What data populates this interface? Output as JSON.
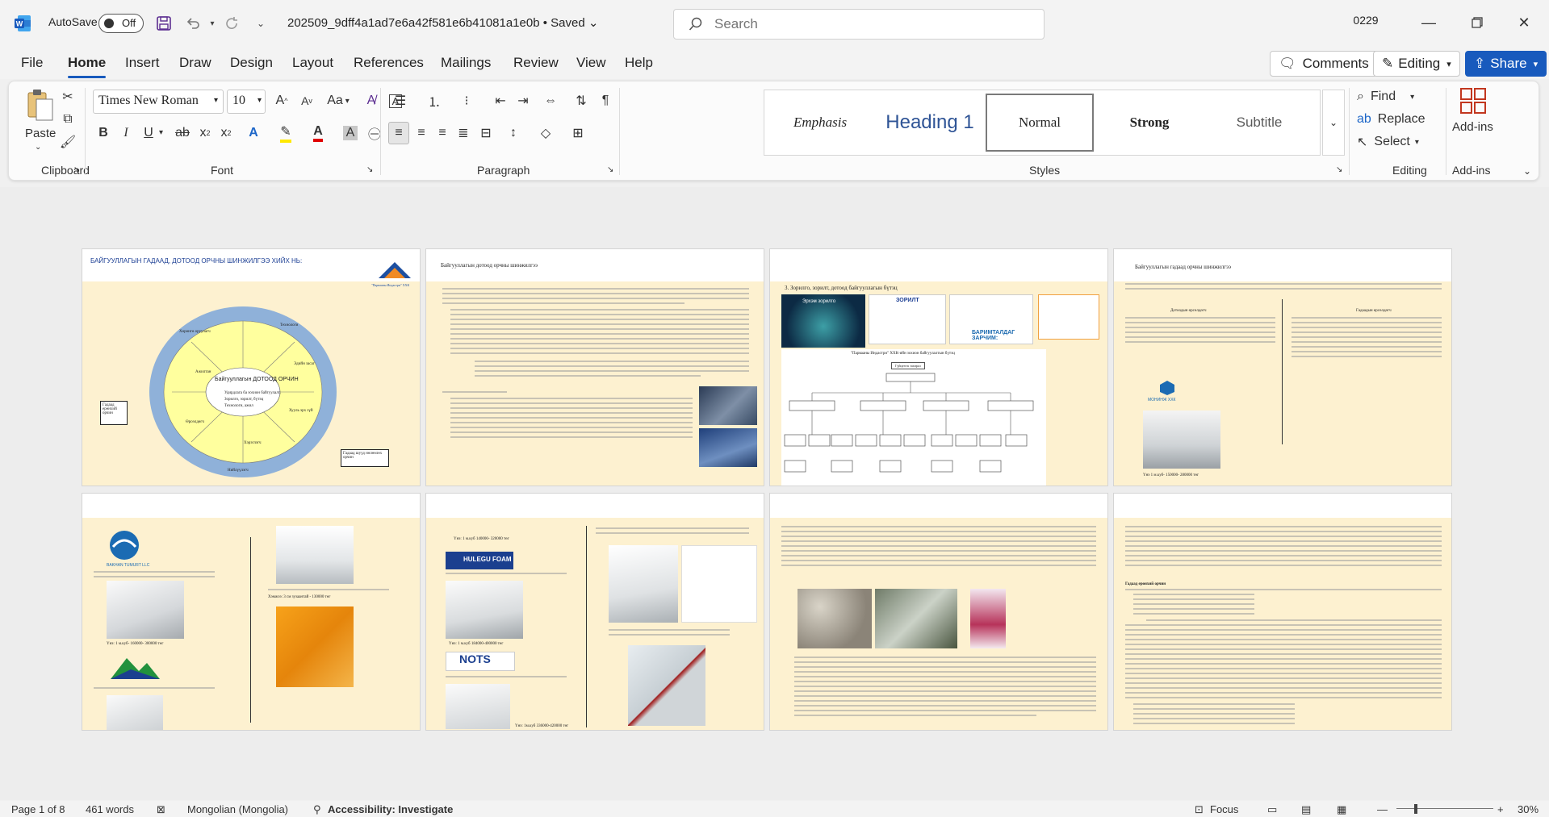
{
  "titlebar": {
    "autosave_label": "AutoSave",
    "autosave_state": "Off",
    "document_title": "202509_9dff4a1ad7e6a42f581e6b41081a1e0b",
    "save_status": "Saved",
    "user_badge": "0229"
  },
  "search": {
    "placeholder": "Search"
  },
  "menu": {
    "tabs": [
      "File",
      "Home",
      "Insert",
      "Draw",
      "Design",
      "Layout",
      "References",
      "Mailings",
      "Review",
      "View",
      "Help"
    ],
    "comments_label": "Comments",
    "editing_label": "Editing",
    "share_label": "Share"
  },
  "ribbon": {
    "clipboard": {
      "paste_label": "Paste",
      "group_label": "Clipboard"
    },
    "font": {
      "family": "Times New Roman",
      "size": "10",
      "group_label": "Font",
      "change_case": "Aa"
    },
    "paragraph": {
      "group_label": "Paragraph"
    },
    "styles": {
      "group_label": "Styles",
      "items": [
        "Emphasis",
        "Heading 1",
        "Normal",
        "Strong",
        "Subtitle"
      ],
      "selected": "Normal"
    },
    "editing": {
      "group_label": "Editing",
      "find": "Find",
      "replace": "Replace",
      "select": "Select"
    },
    "addins": {
      "label": "Add-ins",
      "group_label": "Add-ins"
    }
  },
  "pages": {
    "p1": {
      "heading": "БАЙГУУЛЛАГЫН ГАДААД, ДОТООД ОРЧНЫ ШИНЖИЛГЭЭ ХИЙХ НЬ:",
      "logo_caption": "\"Парвааны Индастри\" ХХК",
      "center_title": "Байгууллагын ДОТООД ОРЧИН",
      "center_items": [
        "Удирдлага ба зохион байгуулалт,",
        "Зорилго, зорилт, бүтэц",
        "Технологи, ажил"
      ],
      "outer_label": "Гадаад орчин",
      "sector_labels": [
        "Хөрөнгө оруулагч",
        "Технологи",
        "Эдийн засаг",
        "Ажилтан",
        "Хууль эрх зүй",
        "Өрсөлдөгч",
        "Хэрэглэгч",
        "Нийлүүлэгч"
      ],
      "box_left": "Гадаад ерөнхий орчин",
      "box_right": "Гадаад шууд нөлөөлөх орчин"
    },
    "p2": {
      "heading": "Байгууллагын дотоод орчны шинжилгээ"
    },
    "p3": {
      "item": "3.  Зорилго, зорилт, дотоод байгууллагын бүтэц",
      "goal_title": "ЗОРИЛТ",
      "vision_title": "Эрхэм зорилго",
      "values_title": "БАРИМТАЛДАГ ЗАРЧИМ:",
      "org_title": "\"Парвааны Индастри\" ХХК-ийн зохион байгуулалтын бүтэц",
      "ceo": "Гүйцэтгэх захирал"
    },
    "p4": {
      "heading": "Байгууллагын гадаад орчны шинжилгээ",
      "col_left": "Дотоодын өрсөлдөгч",
      "col_right": "Гадаадын өрсөлдөгч",
      "caption_left": "Үнэ 1 м.куб- 150000- 280000 төг",
      "brand": "МОНИНЖ ХХК"
    },
    "p5": {
      "brand_a": "BAKHAN TUMURT LLC",
      "caption_a": "Үнэ: 1 м.куб- 160000- 300000 төг",
      "caption_b": "Хэмжээ: 3 см зузаантай - 130000 төг"
    },
    "p6": {
      "price_top": "Үнэ: 1 м.куб 140000- 320000 төг",
      "brand_b": "HULEGU FOAM",
      "price_mid": "Үнэ: 1 м.куб 184000-400000 төг",
      "brand_c": "NOTS",
      "price_bottom": "Үнэ: 1м.куб 336000-420000 төг"
    },
    "p7": {},
    "p8": {
      "heading_a": "Гадаад ерөнхий орчин"
    }
  },
  "status": {
    "page": "Page 1 of 8",
    "words": "461 words",
    "language": "Mongolian (Mongolia)",
    "accessibility": "Accessibility: Investigate",
    "focus": "Focus",
    "zoom": "30%"
  },
  "colors": {
    "accent": "#185abd",
    "page_tint": "#fdf1d0",
    "ring": "#8fb1d9",
    "sector": "#ffff9e"
  }
}
